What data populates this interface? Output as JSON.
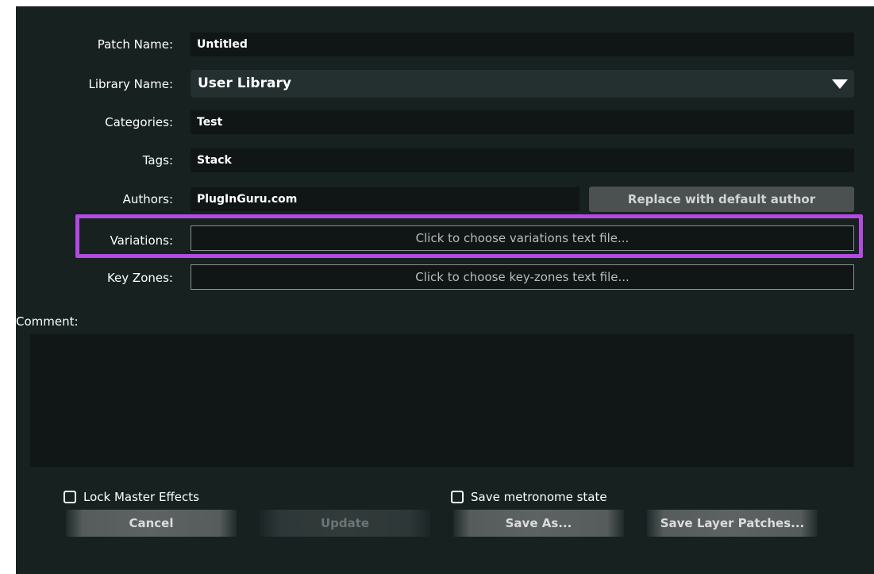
{
  "form": {
    "patch_name": {
      "label": "Patch Name:",
      "value": "Untitled"
    },
    "library_name": {
      "label": "Library Name:",
      "value": "User Library"
    },
    "categories": {
      "label": "Categories:",
      "value": "Test"
    },
    "tags": {
      "label": "Tags:",
      "value": "Stack"
    },
    "authors": {
      "label": "Authors:",
      "value": "PlugInGuru.com",
      "replace_button": "Replace with default author"
    },
    "variations": {
      "label": "Variations:",
      "button": "Click to choose variations text file..."
    },
    "key_zones": {
      "label": "Key Zones:",
      "button": "Click to choose key-zones text file..."
    },
    "comment": {
      "label": "Comment:",
      "value": ""
    }
  },
  "options": {
    "lock_master_effects": {
      "label": "Lock Master Effects",
      "checked": false
    },
    "save_metronome_state": {
      "label": "Save metronome state",
      "checked": false
    }
  },
  "buttons": {
    "cancel": "Cancel",
    "update": "Update",
    "save_as": "Save As...",
    "save_layer_patches": "Save Layer Patches..."
  },
  "colors": {
    "background": "#162120",
    "highlight": "#b44be1"
  }
}
